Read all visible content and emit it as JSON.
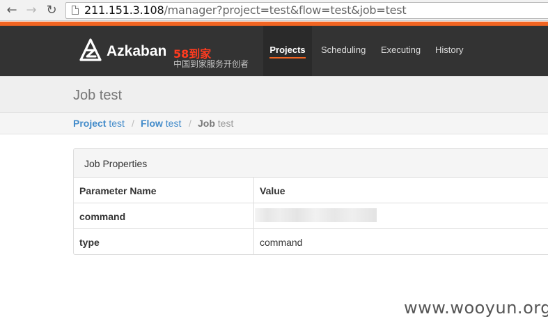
{
  "browser": {
    "url_host": "211.151.3.108",
    "url_path": "/manager?project=test&flow=test&job=test",
    "back_icon": "←",
    "forward_icon": "→",
    "reload_icon": "↻"
  },
  "header": {
    "brand": "Azkaban",
    "brand_cn": "58到家",
    "tagline": "中国到家服务开创者",
    "nav": [
      "Projects",
      "Scheduling",
      "Executing",
      "History"
    ],
    "active_nav": "Projects",
    "accent_color": "#f26522"
  },
  "page": {
    "title": "Job test"
  },
  "breadcrumb": {
    "project_label": "Project",
    "project_name": "test",
    "flow_label": "Flow",
    "flow_name": "test",
    "job_label": "Job",
    "job_name": "test",
    "separator": "/"
  },
  "properties": {
    "panel_title": "Job Properties",
    "col_param": "Parameter Name",
    "col_value": "Value",
    "rows": [
      {
        "name": "command",
        "value": ""
      },
      {
        "name": "type",
        "value": "command"
      }
    ]
  },
  "watermark": "www.wooyun.org"
}
